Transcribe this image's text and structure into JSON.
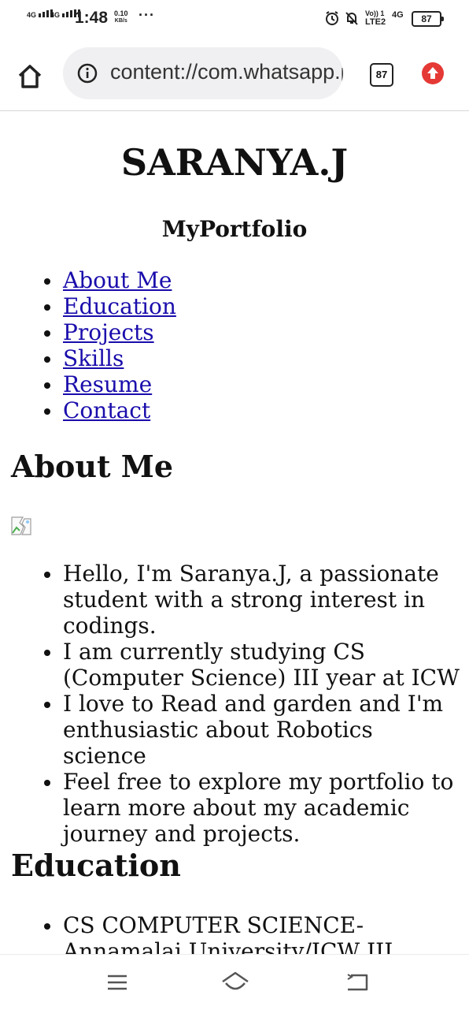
{
  "status_bar": {
    "sim1": "4G",
    "sim2": "4G",
    "time": "1:48",
    "speed_value": "0.10",
    "speed_unit": "KB/s",
    "more": "···",
    "volte_line1": "Vo)) 1",
    "volte_line2": "LTE2",
    "network": "4G",
    "battery": "87"
  },
  "browser": {
    "url": "content://com.whatsapp.provider.media/item/",
    "tab_count": "87",
    "icons": [
      "home-icon",
      "info-icon",
      "tab-switcher-icon",
      "update-icon"
    ]
  },
  "page": {
    "title": "SARANYA.J",
    "subtitle": "MyPortfolio",
    "nav": [
      "About Me",
      "Education",
      "Projects",
      "Skills",
      "Resume",
      "Contact"
    ],
    "about_heading": "About Me",
    "about_items": [
      "Hello, I'm Saranya.J, a passionate student with a strong interest in codings.",
      "I am currently studying CS (Computer Science) III year at ICW",
      "I love to Read and garden and I'm enthusiastic about Robotics science",
      "Feel free to explore my portfolio to learn more about my academic journey and projects."
    ],
    "education_heading": "Education",
    "education_items": [
      "CS COMPUTER SCIENCE- Annamalai University/ICW III YEAR"
    ]
  },
  "system_nav": {
    "icons": [
      "recent-apps-icon",
      "home-icon",
      "back-icon"
    ]
  },
  "colors": {
    "link": "#1a0dab",
    "update_badge": "#e53935",
    "url_bar_bg": "#f0f0f2"
  }
}
